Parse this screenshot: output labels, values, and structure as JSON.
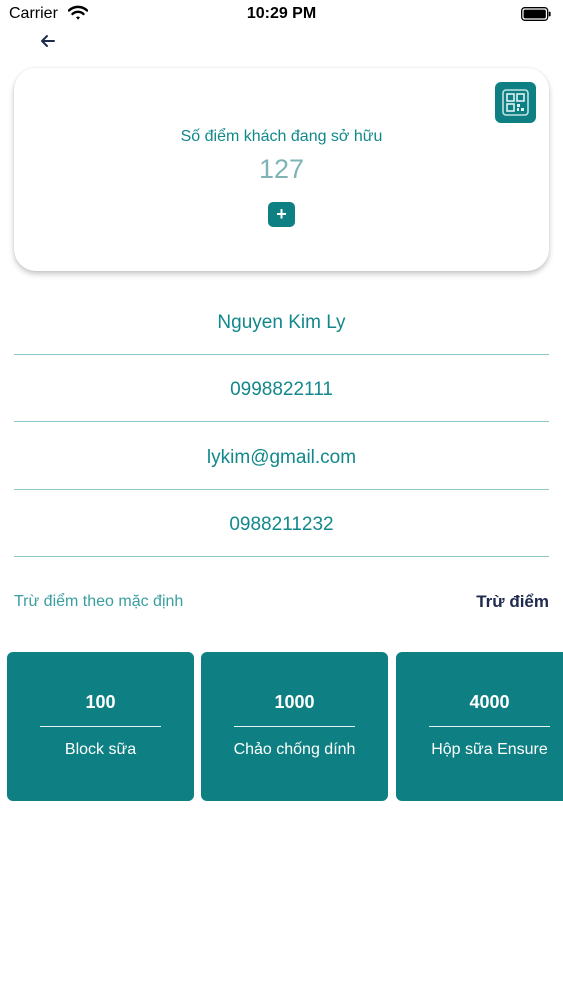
{
  "status_bar": {
    "carrier": "Carrier",
    "time": "10:29 PM"
  },
  "points_card": {
    "label": "Số điểm khách đang sở hữu",
    "points": "127",
    "add_symbol": "+"
  },
  "customer": {
    "name": "Nguyen Kim Ly",
    "phone": "0998822111",
    "email": "lykim@gmail.com",
    "phone2": "0988211232"
  },
  "deduct": {
    "default_label": "Trừ điểm theo mặc định",
    "action_label": "Trừ điểm"
  },
  "rewards": [
    {
      "points": "100",
      "name": "Block sữa"
    },
    {
      "points": "1000",
      "name": "Chảo chống dính"
    },
    {
      "points": "4000",
      "name": "Hộp sữa Ensure"
    }
  ],
  "colors": {
    "accent": "#0e8083",
    "text_teal": "#12888b",
    "deduct_text": "#1f2a4d"
  },
  "icons": {
    "back": "back-arrow-icon",
    "qr": "qr-code-icon",
    "add": "plus-icon"
  }
}
